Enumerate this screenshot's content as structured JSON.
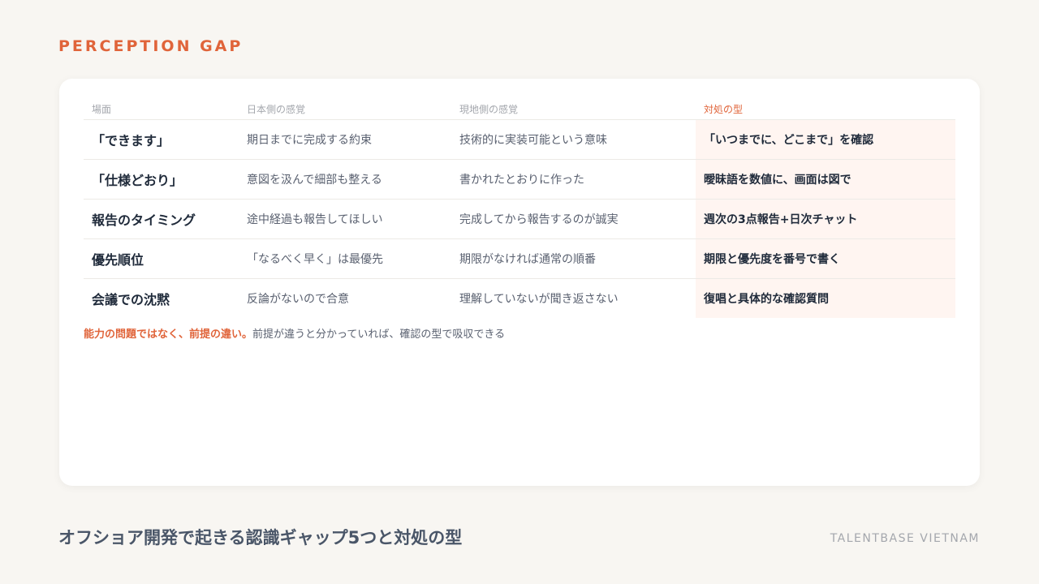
{
  "eyebrow": "PERCEPTION GAP",
  "table": {
    "headers": [
      "場面",
      "日本側の感覚",
      "現地側の感覚",
      "対処の型"
    ],
    "rows": [
      {
        "scene": "「できます」",
        "japan": "期日までに完成する約束",
        "local": "技術的に実装可能という意味",
        "fix": "「いつまでに、どこまで」を確認"
      },
      {
        "scene": "「仕様どおり」",
        "japan": "意図を汲んで細部も整える",
        "local": "書かれたとおりに作った",
        "fix": "曖昧語を数値に、画面は図で"
      },
      {
        "scene": "報告のタイミング",
        "japan": "途中経過も報告してほしい",
        "local": "完成してから報告するのが誠実",
        "fix": "週次の3点報告+日次チャット"
      },
      {
        "scene": "優先順位",
        "japan": "「なるべく早く」は最優先",
        "local": "期限がなければ通常の順番",
        "fix": "期限と優先度を番号で書く"
      },
      {
        "scene": "会議での沈黙",
        "japan": "反論がないので合意",
        "local": "理解していないが聞き返さない",
        "fix": "復唱と具体的な確認質問"
      }
    ]
  },
  "note": {
    "emphasis": "能力の問題ではなく、前提の違い。",
    "text": "前提が違うと分かっていれば、確認の型で吸収できる"
  },
  "footer": {
    "title": "オフショア開発で起きる認識ギャップ5つと対処の型",
    "brand": "TALENTBASE VIETNAM"
  },
  "colors": {
    "accent": "#e0643a",
    "background": "#f8f6f2",
    "card": "#ffffff",
    "highlight": "#fff5f1",
    "text_dark": "#1f2a3a",
    "text_muted": "#5a6170"
  }
}
